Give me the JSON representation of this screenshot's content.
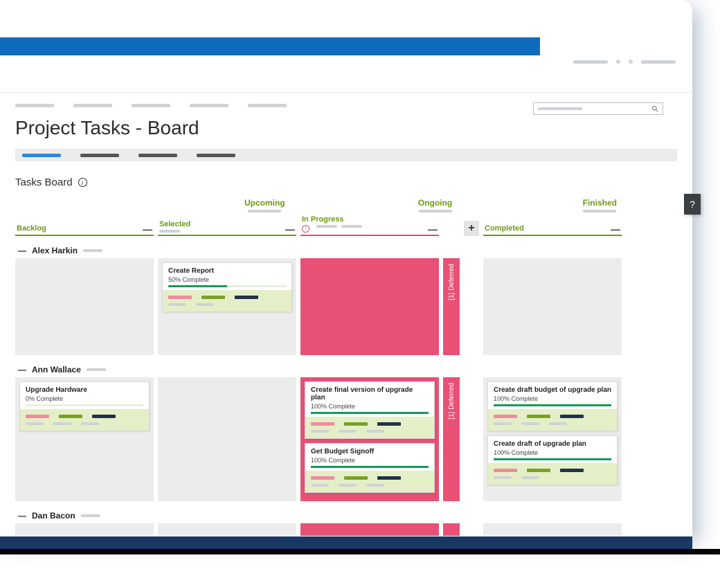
{
  "page": {
    "title": "Project Tasks - Board",
    "section": "Tasks Board"
  },
  "stages": {
    "upcoming": "Upcoming",
    "ongoing": "Ongoing",
    "finished": "Finished"
  },
  "columns": {
    "backlog": "Backlog",
    "selected": "Selected",
    "inprogress": "In Progress",
    "completed": "Completed"
  },
  "deferred_label": "[1] Deferred",
  "people": [
    {
      "name": "Alex Harkin",
      "lanes": {
        "backlog": [],
        "selected": [
          {
            "title": "Create Report",
            "progress_label": "50% Complete",
            "progress": 50
          }
        ],
        "inprogress": [],
        "deferred": true,
        "completed": []
      }
    },
    {
      "name": "Ann Wallace",
      "lanes": {
        "backlog": [
          {
            "title": "Upgrade Hardware",
            "progress_label": "0% Complete",
            "progress": 0
          }
        ],
        "selected": [],
        "inprogress": [
          {
            "title": "Create final version of upgrade plan",
            "progress_label": "100% Complete",
            "progress": 100
          },
          {
            "title": "Get Budget Signoff",
            "progress_label": "100% Complete",
            "progress": 100
          }
        ],
        "deferred": true,
        "completed": [
          {
            "title": "Create draft budget of upgrade plan",
            "progress_label": "100% Complete",
            "progress": 100
          },
          {
            "title": "Create draft of upgrade plan",
            "progress_label": "100% Complete",
            "progress": 100
          }
        ]
      }
    },
    {
      "name": "Dan Bacon",
      "lanes": {
        "backlog": [],
        "selected": [],
        "inprogress": [],
        "deferred": false,
        "completed": []
      }
    }
  ],
  "help": "?"
}
